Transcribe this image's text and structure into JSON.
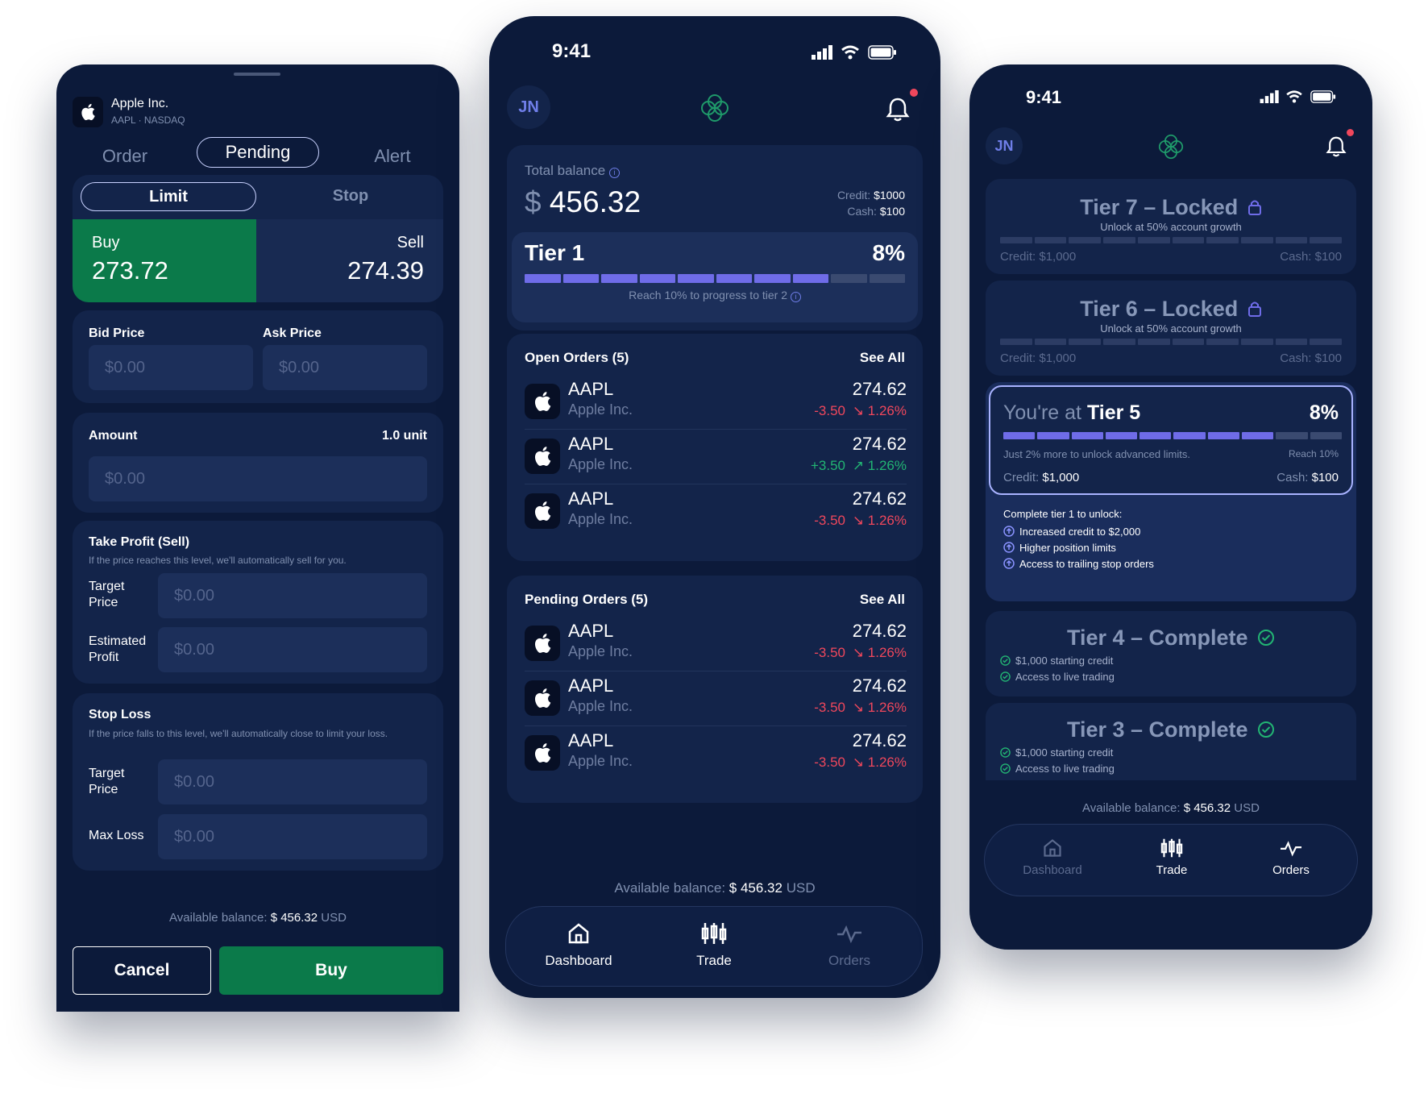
{
  "colors": {
    "background": "#0c1a3a",
    "card": "#13244a",
    "field": "#1c2f5a",
    "buy_green": "#0b7a4a",
    "accent_purple": "#6f6ce8",
    "negative": "#f0475c",
    "positive": "#22b573"
  },
  "order_screen": {
    "company": "Apple Inc.",
    "ticker_exchange": "AAPL · NASDAQ",
    "logo_icon": "apple-logo-icon",
    "tabs": [
      "Order",
      "Pending",
      "Alert"
    ],
    "selected_tab": "Pending",
    "order_types": [
      "Limit",
      "Stop"
    ],
    "selected_order_type": "Limit",
    "buy": {
      "label": "Buy",
      "price": "273.72"
    },
    "sell": {
      "label": "Sell",
      "price": "274.39"
    },
    "bid_label": "Bid Price",
    "ask_label": "Ask Price",
    "bid_placeholder": "$0.00",
    "ask_placeholder": "$0.00",
    "amount_label": "Amount",
    "amount_unit": "1.0 unit",
    "amount_placeholder": "$0.00",
    "take_profit": {
      "title": "Take Profit (Sell)",
      "description": "If the price reaches this level, we'll automatically sell for you.",
      "target_label": "Target Price",
      "target_placeholder": "$0.00",
      "estimated_label": "Estimated Profit",
      "estimated_placeholder": "$0.00"
    },
    "stop_loss": {
      "title": "Stop Loss",
      "description": "If the price falls to this level, we'll automatically close to limit your loss.",
      "target_label": "Target Price",
      "target_placeholder": "$0.00",
      "max_loss_label": "Max Loss",
      "max_loss_placeholder": "$0.00"
    },
    "available_prefix": "Available balance:",
    "available_amount": "$ 456.32",
    "available_currency": "USD",
    "cancel_label": "Cancel",
    "submit_label": "Buy"
  },
  "dashboard_screen": {
    "time": "9:41",
    "avatar_initials": "JN",
    "total_balance_label": "Total balance",
    "currency_symbol": "$",
    "total_balance": "456.32",
    "credit_label": "Credit:",
    "credit_value": "$1000",
    "cash_label": "Cash:",
    "cash_value": "$100",
    "tier_name": "Tier 1",
    "tier_percent": "8%",
    "tier_progress_filled": 8,
    "tier_progress_total": 10,
    "tier_hint": "Reach 10% to progress to tier 2",
    "open_orders_title": "Open Orders (5)",
    "pending_orders_title": "Pending Orders (5)",
    "see_all": "See All",
    "open_orders": [
      {
        "symbol": "AAPL",
        "name": "Apple Inc.",
        "price": "274.62",
        "change": "-3.50",
        "percent": "1.26%",
        "direction": "down"
      },
      {
        "symbol": "AAPL",
        "name": "Apple Inc.",
        "price": "274.62",
        "change": "+3.50",
        "percent": "1.26%",
        "direction": "up"
      },
      {
        "symbol": "AAPL",
        "name": "Apple Inc.",
        "price": "274.62",
        "change": "-3.50",
        "percent": "1.26%",
        "direction": "down"
      }
    ],
    "pending_orders": [
      {
        "symbol": "AAPL",
        "name": "Apple Inc.",
        "price": "274.62",
        "change": "-3.50",
        "percent": "1.26%",
        "direction": "down"
      },
      {
        "symbol": "AAPL",
        "name": "Apple Inc.",
        "price": "274.62",
        "change": "-3.50",
        "percent": "1.26%",
        "direction": "down"
      },
      {
        "symbol": "AAPL",
        "name": "Apple Inc.",
        "price": "274.62",
        "change": "-3.50",
        "percent": "1.26%",
        "direction": "down"
      }
    ],
    "available_prefix": "Available balance:",
    "available_amount": "$ 456.32",
    "available_currency": "USD",
    "nav": [
      "Dashboard",
      "Trade",
      "Orders"
    ],
    "nav_active": [
      "Dashboard",
      "Trade"
    ]
  },
  "tiers_screen": {
    "time": "9:41",
    "avatar_initials": "JN",
    "tier7": {
      "title": "Tier 7 – Locked",
      "subtitle": "Unlock at 50% account growth",
      "credit": "Credit: $1,000",
      "cash": "Cash: $100"
    },
    "tier6": {
      "title": "Tier 6 – Locked",
      "subtitle": "Unlock at 50% account growth",
      "credit": "Credit: $1,000",
      "cash": "Cash: $100"
    },
    "current": {
      "title_prefix": "You're at",
      "title_tier": "Tier 5",
      "percent": "8%",
      "progress_filled": 8,
      "progress_total": 10,
      "hint": "Just 2% more to unlock advanced limits.",
      "reach": "Reach 10%",
      "credit_label": "Credit:",
      "credit_value": "$1,000",
      "cash_label": "Cash:",
      "cash_value": "$100",
      "unlock_title": "Complete tier 1 to unlock:",
      "unlock_items": [
        "Increased credit to $2,000",
        "Higher position limits",
        "Access to trailing stop orders"
      ]
    },
    "tier4": {
      "title": "Tier 4 – Complete",
      "items": [
        "$1,000 starting credit",
        "Access to live trading"
      ]
    },
    "tier3": {
      "title": "Tier 3 – Complete",
      "items": [
        "$1,000 starting credit",
        "Access to live trading"
      ]
    },
    "available_prefix": "Available balance:",
    "available_amount": "$ 456.32",
    "available_currency": "USD",
    "nav": [
      "Dashboard",
      "Trade",
      "Orders"
    ],
    "nav_active": [
      "Trade",
      "Orders"
    ]
  }
}
